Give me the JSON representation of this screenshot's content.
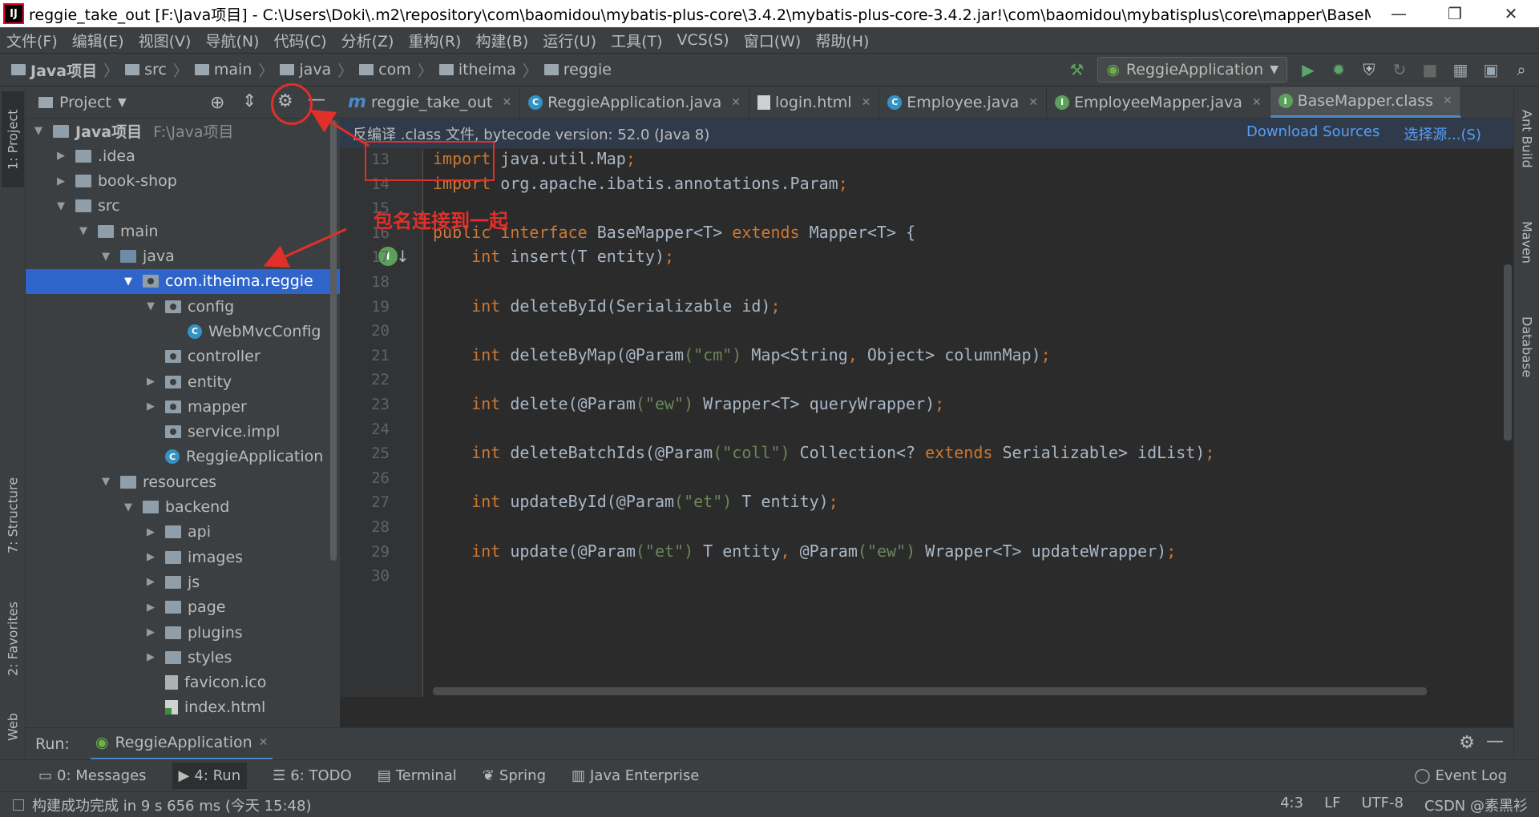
{
  "window": {
    "title": "reggie_take_out [F:\\Java项目] - C:\\Users\\Doki\\.m2\\repository\\com\\baomidou\\mybatis-plus-core\\3.4.2\\mybatis-plus-core-3.4.2.jar!\\com\\baomidou\\mybatisplus\\core\\mapper\\BaseMapper.class [...",
    "app_icon_label": "IJ"
  },
  "menu": [
    "文件(F)",
    "编辑(E)",
    "视图(V)",
    "导航(N)",
    "代码(C)",
    "分析(Z)",
    "重构(R)",
    "构建(B)",
    "运行(U)",
    "工具(T)",
    "VCS(S)",
    "窗口(W)",
    "帮助(H)"
  ],
  "breadcrumb": [
    "Java项目",
    "src",
    "main",
    "java",
    "com",
    "itheima",
    "reggie"
  ],
  "run_config": "ReggieApplication",
  "project_panel": {
    "title": "Project",
    "tree": [
      {
        "label": "Java项目",
        "path": "F:\\Java项目",
        "expanded": true,
        "kind": "folder",
        "depth": 0
      },
      {
        "label": ".idea",
        "expanded": false,
        "kind": "folder",
        "depth": 1
      },
      {
        "label": "book-shop",
        "expanded": false,
        "kind": "folder",
        "depth": 1
      },
      {
        "label": "src",
        "expanded": true,
        "kind": "folder",
        "depth": 1
      },
      {
        "label": "main",
        "expanded": true,
        "kind": "folder",
        "depth": 2
      },
      {
        "label": "java",
        "expanded": true,
        "kind": "src",
        "depth": 3
      },
      {
        "label": "com.itheima.reggie",
        "expanded": true,
        "kind": "pkg",
        "depth": 4,
        "selected": true
      },
      {
        "label": "config",
        "expanded": true,
        "kind": "pkg",
        "depth": 5
      },
      {
        "label": "WebMvcConfig",
        "kind": "class",
        "depth": 6
      },
      {
        "label": "controller",
        "kind": "pkg",
        "depth": 5
      },
      {
        "label": "entity",
        "expanded": false,
        "kind": "pkg",
        "depth": 5
      },
      {
        "label": "mapper",
        "expanded": false,
        "kind": "pkg",
        "depth": 5
      },
      {
        "label": "service.impl",
        "kind": "pkg",
        "depth": 5
      },
      {
        "label": "ReggieApplication",
        "kind": "class",
        "depth": 5
      },
      {
        "label": "resources",
        "expanded": true,
        "kind": "folder",
        "depth": 3
      },
      {
        "label": "backend",
        "expanded": true,
        "kind": "folder",
        "depth": 4
      },
      {
        "label": "api",
        "expanded": false,
        "kind": "folder",
        "depth": 5
      },
      {
        "label": "images",
        "expanded": false,
        "kind": "folder",
        "depth": 5
      },
      {
        "label": "js",
        "expanded": false,
        "kind": "folder",
        "depth": 5
      },
      {
        "label": "page",
        "expanded": false,
        "kind": "folder",
        "depth": 5
      },
      {
        "label": "plugins",
        "expanded": false,
        "kind": "folder",
        "depth": 5
      },
      {
        "label": "styles",
        "expanded": false,
        "kind": "folder",
        "depth": 5
      },
      {
        "label": "favicon.ico",
        "kind": "file",
        "depth": 5
      },
      {
        "label": "index.html",
        "kind": "html",
        "depth": 5
      }
    ]
  },
  "editor_tabs": [
    {
      "label": "reggie_take_out",
      "icon": "m"
    },
    {
      "label": "ReggieApplication.java",
      "icon": "c"
    },
    {
      "label": "login.html",
      "icon": "h"
    },
    {
      "label": "Employee.java",
      "icon": "c"
    },
    {
      "label": "EmployeeMapper.java",
      "icon": "i"
    },
    {
      "label": "BaseMapper.class",
      "icon": "i",
      "active": true
    }
  ],
  "banner": {
    "text": "反编译 .class 文件, bytecode version: 52.0 (Java 8)",
    "download_sources": "Download Sources",
    "choose_sources": "选择源...(S)"
  },
  "code": {
    "line_numbers": [
      "13",
      "14",
      "15",
      "16",
      "17",
      "18",
      "19",
      "20",
      "21",
      "22",
      "23",
      "24",
      "25",
      "26",
      "27",
      "28",
      "29",
      "30"
    ],
    "lines": [
      [
        {
          "t": "import",
          "c": "kw"
        },
        {
          "t": " java.util.Map"
        },
        {
          "t": ";",
          "c": "kw"
        }
      ],
      [
        {
          "t": "import",
          "c": "kw"
        },
        {
          "t": " org.apache.ibatis.annotations.Param"
        },
        {
          "t": ";",
          "c": "kw"
        }
      ],
      [],
      [
        {
          "t": "public interface ",
          "c": "kw"
        },
        {
          "t": "BaseMapper<T> "
        },
        {
          "t": "extends ",
          "c": "kw"
        },
        {
          "t": "Mapper<T> {"
        }
      ],
      [
        {
          "t": "    "
        },
        {
          "t": "int ",
          "c": "kw"
        },
        {
          "t": "insert(T entity)"
        },
        {
          "t": ";",
          "c": "kw"
        }
      ],
      [],
      [
        {
          "t": "    "
        },
        {
          "t": "int ",
          "c": "kw"
        },
        {
          "t": "deleteById(Serializable id)"
        },
        {
          "t": ";",
          "c": "kw"
        }
      ],
      [],
      [
        {
          "t": "    "
        },
        {
          "t": "int ",
          "c": "kw"
        },
        {
          "t": "deleteByMap("
        },
        {
          "t": "@Param",
          "c": "ann2"
        },
        {
          "t": "(\"cm\")",
          "c": "str"
        },
        {
          "t": " Map<String"
        },
        {
          "t": ",",
          "c": "kw"
        },
        {
          "t": " Object> columnMap)"
        },
        {
          "t": ";",
          "c": "kw"
        }
      ],
      [],
      [
        {
          "t": "    "
        },
        {
          "t": "int ",
          "c": "kw"
        },
        {
          "t": "delete("
        },
        {
          "t": "@Param",
          "c": "ann2"
        },
        {
          "t": "(\"ew\")",
          "c": "str"
        },
        {
          "t": " Wrapper<T> queryWrapper)"
        },
        {
          "t": ";",
          "c": "kw"
        }
      ],
      [],
      [
        {
          "t": "    "
        },
        {
          "t": "int ",
          "c": "kw"
        },
        {
          "t": "deleteBatchIds("
        },
        {
          "t": "@Param",
          "c": "ann2"
        },
        {
          "t": "(\"coll\")",
          "c": "str"
        },
        {
          "t": " Collection<? "
        },
        {
          "t": "extends ",
          "c": "kw"
        },
        {
          "t": "Serializable> idList)"
        },
        {
          "t": ";",
          "c": "kw"
        }
      ],
      [],
      [
        {
          "t": "    "
        },
        {
          "t": "int ",
          "c": "kw"
        },
        {
          "t": "updateById("
        },
        {
          "t": "@Param",
          "c": "ann2"
        },
        {
          "t": "(\"et\")",
          "c": "str"
        },
        {
          "t": " T entity)"
        },
        {
          "t": ";",
          "c": "kw"
        }
      ],
      [],
      [
        {
          "t": "    "
        },
        {
          "t": "int ",
          "c": "kw"
        },
        {
          "t": "update("
        },
        {
          "t": "@Param",
          "c": "ann2"
        },
        {
          "t": "(\"et\")",
          "c": "str"
        },
        {
          "t": " T entity"
        },
        {
          "t": ",",
          "c": "kw"
        },
        {
          "t": " "
        },
        {
          "t": "@Param",
          "c": "ann2"
        },
        {
          "t": "(\"ew\")",
          "c": "str"
        },
        {
          "t": " Wrapper<T> updateWrapper)"
        },
        {
          "t": ";",
          "c": "kw"
        }
      ],
      []
    ]
  },
  "annotation": {
    "text": "包名连接到一起",
    "color": "#e0302a"
  },
  "left_tool_tabs": [
    "1: Project",
    "7: Structure",
    "2: Favorites",
    "Web"
  ],
  "right_tool_tabs": [
    "Ant Build",
    "Maven",
    "Database"
  ],
  "run_panel": {
    "label": "Run:",
    "tab": "ReggieApplication"
  },
  "bottom_tools": [
    {
      "label": "0: Messages"
    },
    {
      "label": "4: Run",
      "active": true
    },
    {
      "label": "6: TODO"
    },
    {
      "label": "Terminal"
    },
    {
      "label": "Spring"
    },
    {
      "label": "Java Enterprise"
    }
  ],
  "event_log": "Event Log",
  "status": {
    "message": "构建成功完成 in 9 s 656 ms (今天 15:48)",
    "position": "4:3",
    "line_sep": "LF",
    "encoding": "UTF-8",
    "watermark": "CSDN @素黑衫"
  },
  "colors": {
    "accent": "#4a88c7",
    "selection": "#2f65ca",
    "keyword": "#cc7832",
    "string": "#6a8759"
  }
}
